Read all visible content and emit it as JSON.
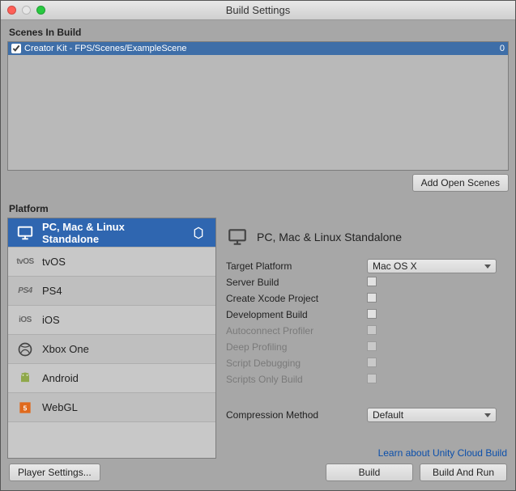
{
  "window": {
    "title": "Build Settings"
  },
  "sections": {
    "scenes_header": "Scenes In Build",
    "platform_header": "Platform"
  },
  "scenes": [
    {
      "enabled": true,
      "path": "Creator Kit - FPS/Scenes/ExampleScene",
      "index": "0"
    }
  ],
  "buttons": {
    "add_open_scenes": "Add Open Scenes",
    "player_settings": "Player Settings...",
    "build": "Build",
    "build_and_run": "Build And Run"
  },
  "platforms": [
    {
      "id": "standalone",
      "label": "PC, Mac & Linux Standalone",
      "icon": "monitor-icon",
      "selected": true
    },
    {
      "id": "tvos",
      "label": "tvOS",
      "icon": "tvos-icon"
    },
    {
      "id": "ps4",
      "label": "PS4",
      "icon": "ps4-icon"
    },
    {
      "id": "ios",
      "label": "iOS",
      "icon": "ios-icon"
    },
    {
      "id": "xboxone",
      "label": "Xbox One",
      "icon": "xbox-icon"
    },
    {
      "id": "android",
      "label": "Android",
      "icon": "android-icon"
    },
    {
      "id": "webgl",
      "label": "WebGL",
      "icon": "webgl-icon"
    }
  ],
  "right": {
    "title": "PC, Mac & Linux Standalone",
    "fields": {
      "target_platform": {
        "label": "Target Platform",
        "value": "Mac OS X"
      },
      "server_build": {
        "label": "Server Build",
        "checked": false
      },
      "create_xcode": {
        "label": "Create Xcode Project",
        "checked": false
      },
      "dev_build": {
        "label": "Development Build",
        "checked": false
      },
      "autoconnect": {
        "label": "Autoconnect Profiler",
        "checked": false,
        "disabled": true
      },
      "deep_profiling": {
        "label": "Deep Profiling",
        "checked": false,
        "disabled": true
      },
      "script_debugging": {
        "label": "Script Debugging",
        "checked": false,
        "disabled": true
      },
      "scripts_only": {
        "label": "Scripts Only Build",
        "checked": false,
        "disabled": true
      },
      "compression": {
        "label": "Compression Method",
        "value": "Default"
      }
    },
    "link": "Learn about Unity Cloud Build"
  }
}
